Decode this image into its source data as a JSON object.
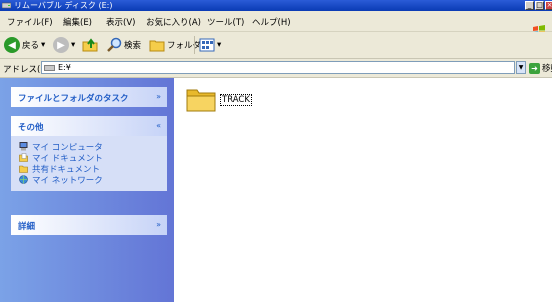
{
  "window": {
    "title": "リムーバブル ディスク (E:)"
  },
  "window_buttons": {
    "minimize": "_",
    "maximize": "□",
    "close": "×"
  },
  "menu": {
    "items": [
      "ファイル(F)",
      "編集(E)",
      "表示(V)",
      "お気に入り(A)",
      "ツール(T)",
      "ヘルプ(H)"
    ]
  },
  "toolbar": {
    "back_label": "戻る",
    "search_label": "検索",
    "folders_label": "フォルダ",
    "dropdown_arrow": "▾"
  },
  "address": {
    "label": "アドレス(D)",
    "value": "E:¥",
    "go_label": "移動"
  },
  "sidebar": {
    "tasks_panel": {
      "title": "ファイルとフォルダのタスク",
      "chevron": "»"
    },
    "other_panel": {
      "title": "その他",
      "chevron": "«",
      "items": [
        "マイ コンピュータ",
        "マイ ドキュメント",
        "共有ドキュメント",
        "マイ ネットワーク"
      ],
      "icons": [
        "my-computer-icon",
        "my-documents-icon",
        "shared-documents-icon",
        "my-network-icon"
      ]
    },
    "details_panel": {
      "title": "詳細",
      "chevron": "»"
    }
  },
  "files": [
    {
      "name": "TRACK",
      "type": "folder",
      "icon": "folder-icon"
    }
  ],
  "colors": {
    "titlebar": "#0a3bb4",
    "chrome": "#ece9d8",
    "sidebar_bg": "#6375d6",
    "panel_bg": "#d6dff7",
    "link_text": "#215dc6"
  }
}
